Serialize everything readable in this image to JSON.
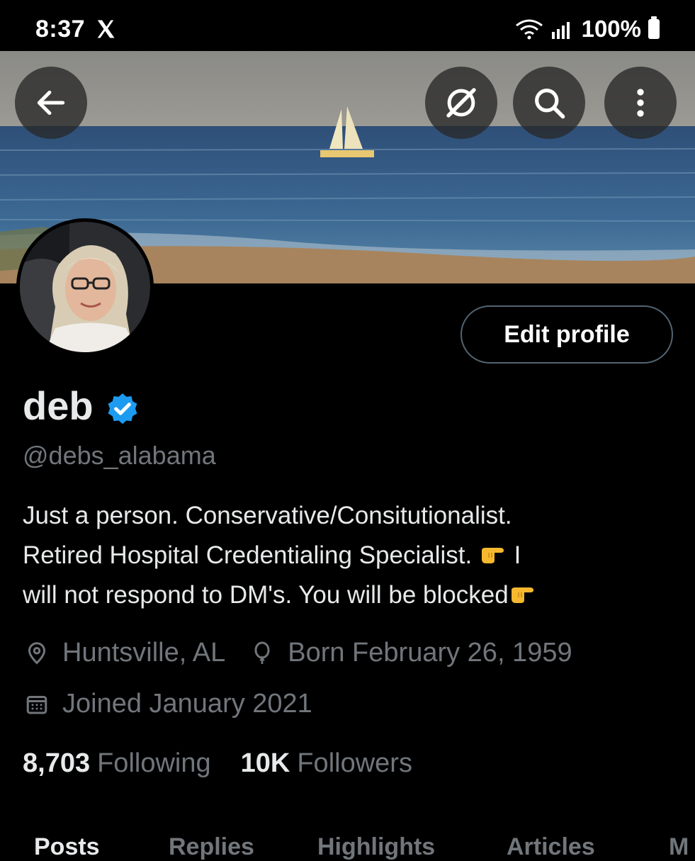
{
  "status_bar": {
    "time": "8:37",
    "battery": "100%",
    "x_logo_icon": "x-logo-icon",
    "wifi_icon": "wifi-icon",
    "signal_icon": "signal-icon",
    "battery_icon": "battery-icon"
  },
  "header": {
    "back_icon": "arrow-left-icon",
    "grok_icon": "grok-icon",
    "search_icon": "search-icon",
    "more_icon": "more-vertical-icon"
  },
  "profile": {
    "edit_label": "Edit profile",
    "display_name": "deb",
    "handle": "@debs_alabama",
    "bio_line1": "Just a person. Conservative/Consitutionalist.",
    "bio_line2_text": "Retired Hospital Credentialing Specialist. ",
    "bio_line2_tail": " I",
    "bio_line3_text": "will not respond to DM's. You will be blocked",
    "location": "Huntsville, AL",
    "birthday": "Born February 26, 1959",
    "joined": "Joined January 2021",
    "following_count": "8,703",
    "following_label": "Following",
    "followers_count": "10K",
    "followers_label": "Followers"
  },
  "tabs": [
    {
      "label": "Posts"
    },
    {
      "label": "Replies"
    },
    {
      "label": "Highlights"
    },
    {
      "label": "Articles"
    },
    {
      "label": "M"
    }
  ],
  "colors": {
    "background": "#000000",
    "verified": "#1d9bf0",
    "secondary_text": "#71767b",
    "primary_text": "#e7e9ea"
  }
}
